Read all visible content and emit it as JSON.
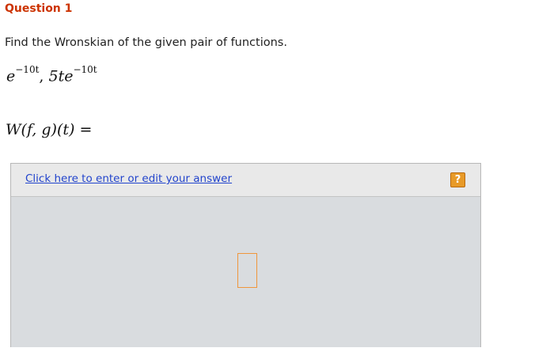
{
  "question": {
    "title": "Question 1",
    "prompt": "Find the Wronskian of the given pair of functions.",
    "functions": {
      "f_base": "e",
      "f_exp": "−10t",
      "separator": ", ",
      "g_base": "5te",
      "g_exp": "−10t"
    },
    "wronskian_expr": "W(f, g)(t) ="
  },
  "answer": {
    "link_text": "Click here to enter or edit your answer",
    "help_label": "?"
  },
  "colors": {
    "title": "#cc3300",
    "link": "#2244cc",
    "help_button": "#e89a28",
    "answer_area": "#d9dcdf"
  }
}
